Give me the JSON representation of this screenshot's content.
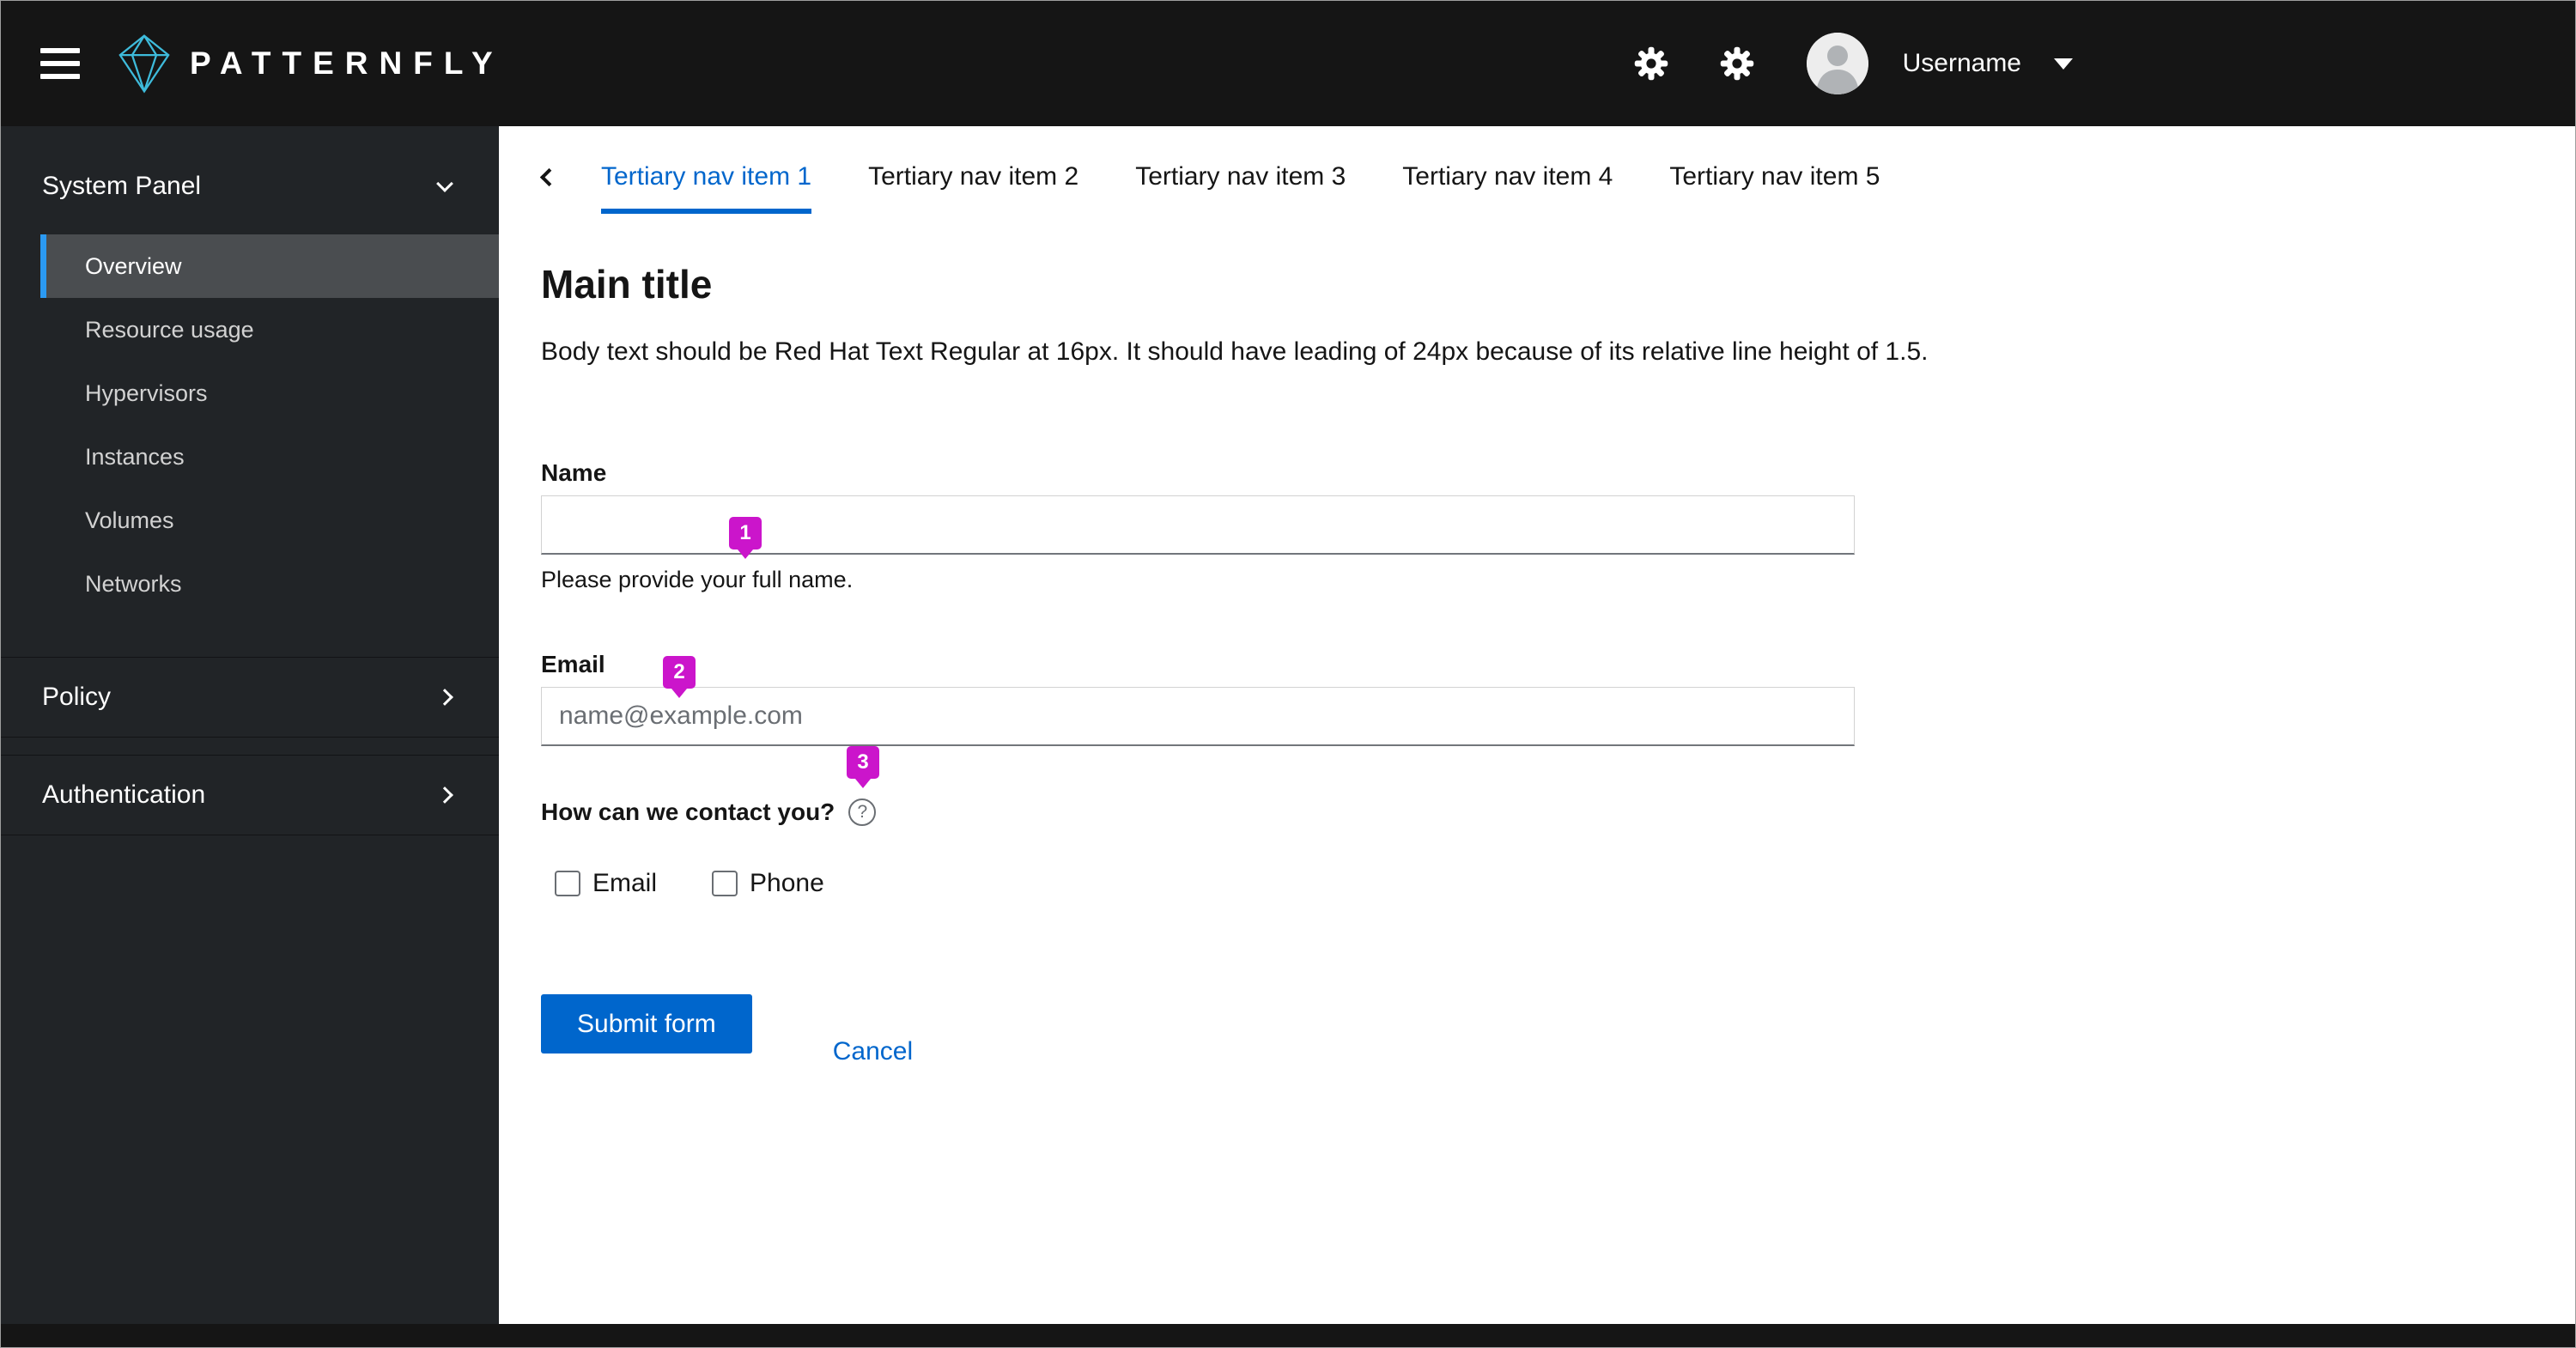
{
  "masthead": {
    "brand": "PATTERNFLY",
    "username": "Username"
  },
  "sidebar": {
    "sections": [
      {
        "label": "System Panel",
        "expanded": true,
        "items": [
          {
            "label": "Overview",
            "selected": true
          },
          {
            "label": "Resource usage",
            "selected": false
          },
          {
            "label": "Hypervisors",
            "selected": false
          },
          {
            "label": "Instances",
            "selected": false
          },
          {
            "label": "Volumes",
            "selected": false
          },
          {
            "label": "Networks",
            "selected": false
          }
        ]
      },
      {
        "label": "Policy",
        "expanded": false
      },
      {
        "label": "Authentication",
        "expanded": false
      }
    ]
  },
  "tabs": {
    "active_index": 0,
    "items": [
      "Tertiary nav item 1",
      "Tertiary nav item 2",
      "Tertiary nav item 3",
      "Tertiary nav item 4",
      "Tertiary nav item 5"
    ]
  },
  "content": {
    "title": "Main title",
    "body_text": "Body text should be Red Hat Text Regular at 16px. It should have leading of 24px because of its relative line height of 1.5.",
    "form": {
      "name": {
        "label": "Name",
        "value": "",
        "helper": "Please provide your full name."
      },
      "email": {
        "label": "Email",
        "placeholder": "name@example.com"
      },
      "contact": {
        "label": "How can we contact you?",
        "help_icon": "question-circle-icon",
        "options": [
          {
            "label": "Email",
            "checked": false
          },
          {
            "label": "Phone",
            "checked": false
          }
        ]
      },
      "submit_label": "Submit form",
      "cancel_label": "Cancel"
    },
    "annotations": [
      {
        "number": "1"
      },
      {
        "number": "2"
      },
      {
        "number": "3"
      }
    ]
  },
  "colors": {
    "primary_blue": "#0066cc",
    "annotation_magenta": "#cb15cb",
    "masthead_bg": "#151515",
    "sidebar_bg": "#212427",
    "nav_selected_bg": "#4a4d50",
    "nav_selected_accent": "#2b9af3",
    "brand_cyan": "#3ebbdb"
  }
}
